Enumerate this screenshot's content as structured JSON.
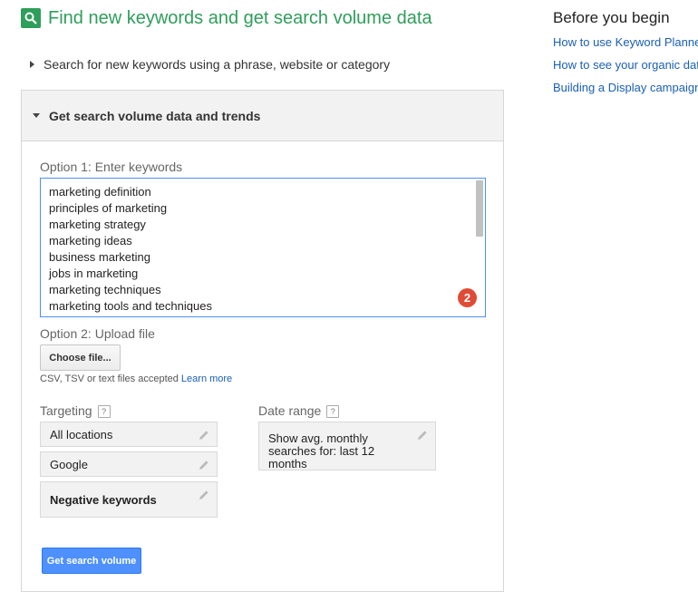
{
  "header": {
    "title": "Find new keywords and get search volume data"
  },
  "collapsed_section": {
    "label": "Search for new keywords using a phrase, website or category"
  },
  "panel": {
    "heading": "Get search volume data and trends",
    "option1_label": "Option 1: Enter keywords",
    "keywords": [
      "marketing definition",
      "principles of marketing",
      "marketing strategy",
      "marketing ideas",
      "business marketing",
      "jobs in marketing",
      "marketing techniques",
      "marketing tools and techniques"
    ],
    "badge": "2",
    "option2_label": "Option 2: Upload file",
    "choose_file_label": "Choose file...",
    "file_hint": "CSV, TSV or text files accepted",
    "learn_more": "Learn more",
    "targeting_label": "Targeting",
    "help_mark": "?",
    "targeting_items": [
      "All locations",
      "Google",
      "Negative keywords"
    ],
    "date_range_label": "Date range",
    "date_range_value": "Show avg. monthly searches for: last 12 months",
    "submit_label": "Get search volume"
  },
  "sidebar": {
    "title": "Before you begin",
    "links": [
      "How to use Keyword Planner",
      "How to see your organic data",
      "Building a Display campaign"
    ]
  },
  "colors": {
    "brand_green": "#2e9e5b",
    "primary_blue": "#4d90fe",
    "link_blue": "#1a5fb4",
    "badge_red": "#e04b36"
  }
}
